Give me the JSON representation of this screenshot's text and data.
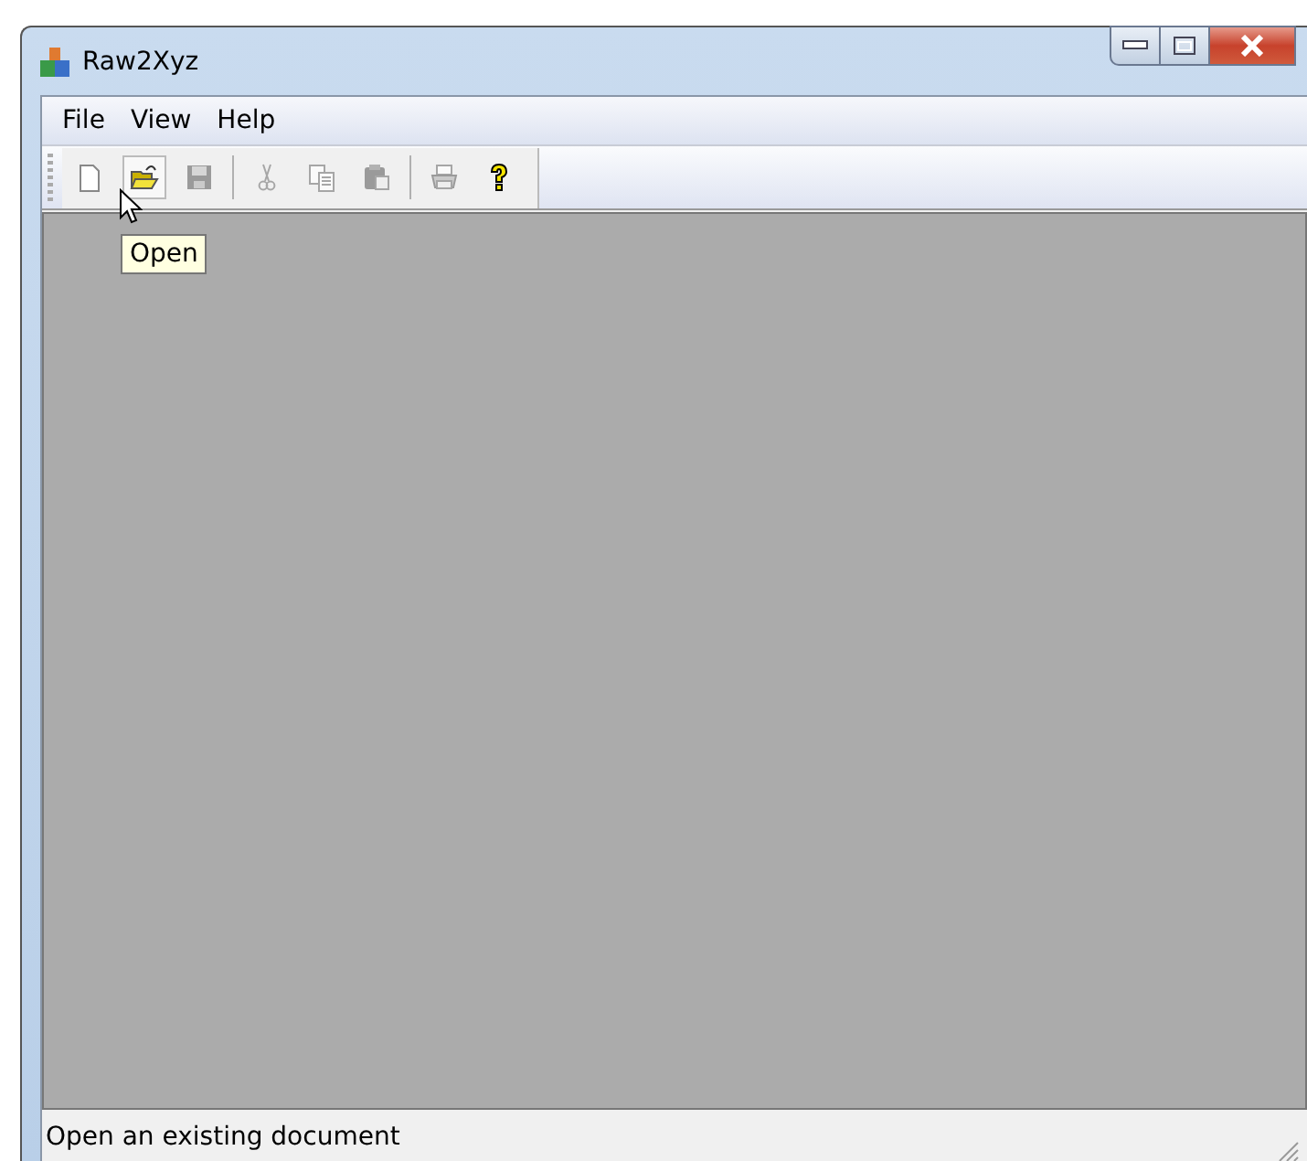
{
  "window": {
    "title": "Raw2Xyz"
  },
  "menu": [
    "File",
    "View",
    "Help"
  ],
  "toolbar": [
    {
      "kind": "new",
      "disabled": false,
      "hovered": false
    },
    {
      "kind": "open",
      "disabled": false,
      "hovered": true
    },
    {
      "kind": "save",
      "disabled": true,
      "hovered": false
    },
    {
      "kind": "sep"
    },
    {
      "kind": "cut",
      "disabled": true,
      "hovered": false
    },
    {
      "kind": "copy",
      "disabled": true,
      "hovered": false
    },
    {
      "kind": "paste",
      "disabled": true,
      "hovered": false
    },
    {
      "kind": "sep"
    },
    {
      "kind": "print",
      "disabled": true,
      "hovered": false
    },
    {
      "kind": "help",
      "disabled": false,
      "hovered": false
    }
  ],
  "tooltip": "Open",
  "status_bar": "Open an existing document"
}
